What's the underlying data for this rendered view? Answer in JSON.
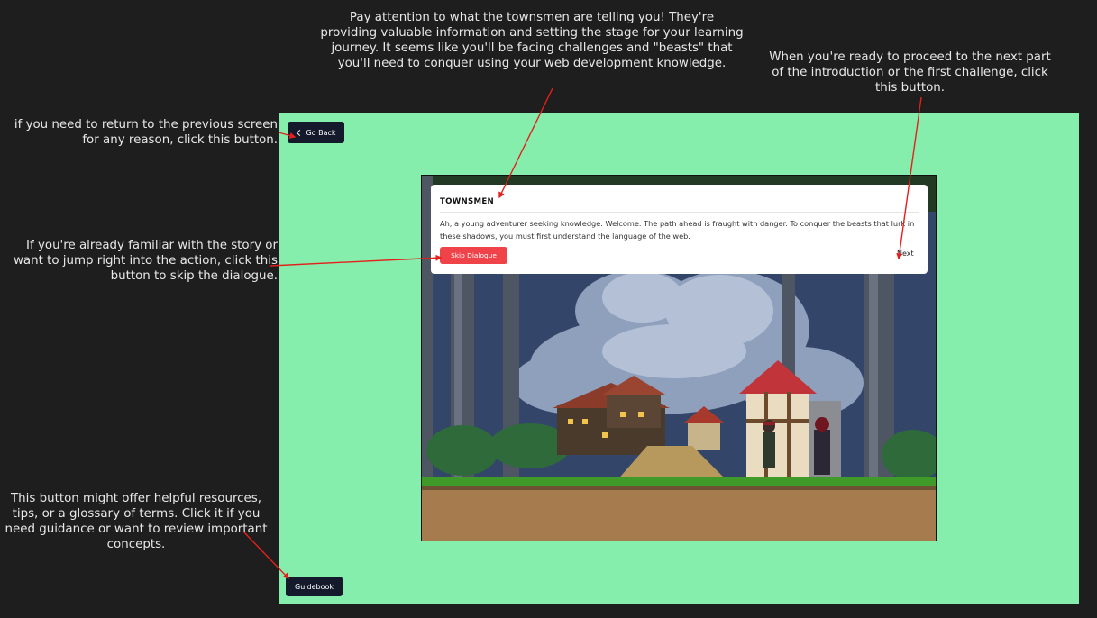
{
  "annotations": {
    "top": "Pay attention to what the townsmen are telling you! They're providing valuable information and setting the stage for your learning journey. It seems like you'll be facing challenges and \"beasts\" that you'll need to conquer using your web development knowledge.",
    "next": "When you're ready to proceed to the next part of the introduction or the first challenge, click this button.",
    "back": "if you need to return to the previous screen for any reason, click this button.",
    "skip": "If you're already familiar with the story or want to jump right into the action, click this button to skip the dialogue.",
    "guidebook": "This button might offer helpful resources, tips, or a glossary of terms. Click it if you need guidance or want to review important concepts."
  },
  "nav": {
    "back_label": "Go Back",
    "guidebook_label": "Guidebook"
  },
  "dialog": {
    "speaker": "TOWNSMEN",
    "text": "Ah, a young adventurer seeking knowledge. Welcome. The path ahead is fraught with danger. To conquer the beasts that lurk in these shadows, you must first understand the language of the web.",
    "skip_label": "Skip Dialogue",
    "next_label": "Next"
  },
  "colors": {
    "stage_bg": "#86eead",
    "button_dark": "#141a2b",
    "skip_red": "#ef4249",
    "arrow_red": "#e3201c"
  },
  "icons": {
    "back": "chevron-left-icon"
  }
}
